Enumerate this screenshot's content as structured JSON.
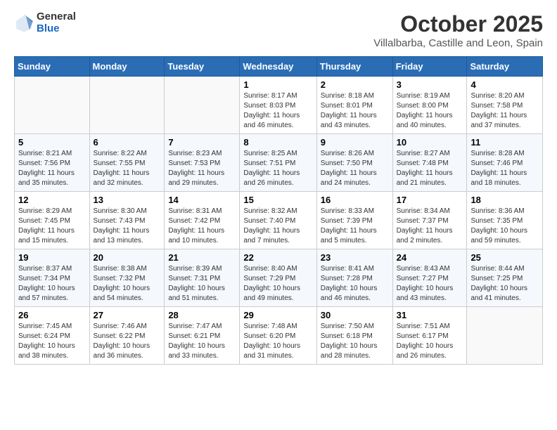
{
  "header": {
    "logo_general": "General",
    "logo_blue": "Blue",
    "month_title": "October 2025",
    "location": "Villalbarba, Castille and Leon, Spain"
  },
  "weekdays": [
    "Sunday",
    "Monday",
    "Tuesday",
    "Wednesday",
    "Thursday",
    "Friday",
    "Saturday"
  ],
  "weeks": [
    [
      {
        "day": "",
        "sunrise": "",
        "sunset": "",
        "daylight": ""
      },
      {
        "day": "",
        "sunrise": "",
        "sunset": "",
        "daylight": ""
      },
      {
        "day": "",
        "sunrise": "",
        "sunset": "",
        "daylight": ""
      },
      {
        "day": "1",
        "sunrise": "Sunrise: 8:17 AM",
        "sunset": "Sunset: 8:03 PM",
        "daylight": "Daylight: 11 hours and 46 minutes."
      },
      {
        "day": "2",
        "sunrise": "Sunrise: 8:18 AM",
        "sunset": "Sunset: 8:01 PM",
        "daylight": "Daylight: 11 hours and 43 minutes."
      },
      {
        "day": "3",
        "sunrise": "Sunrise: 8:19 AM",
        "sunset": "Sunset: 8:00 PM",
        "daylight": "Daylight: 11 hours and 40 minutes."
      },
      {
        "day": "4",
        "sunrise": "Sunrise: 8:20 AM",
        "sunset": "Sunset: 7:58 PM",
        "daylight": "Daylight: 11 hours and 37 minutes."
      }
    ],
    [
      {
        "day": "5",
        "sunrise": "Sunrise: 8:21 AM",
        "sunset": "Sunset: 7:56 PM",
        "daylight": "Daylight: 11 hours and 35 minutes."
      },
      {
        "day": "6",
        "sunrise": "Sunrise: 8:22 AM",
        "sunset": "Sunset: 7:55 PM",
        "daylight": "Daylight: 11 hours and 32 minutes."
      },
      {
        "day": "7",
        "sunrise": "Sunrise: 8:23 AM",
        "sunset": "Sunset: 7:53 PM",
        "daylight": "Daylight: 11 hours and 29 minutes."
      },
      {
        "day": "8",
        "sunrise": "Sunrise: 8:25 AM",
        "sunset": "Sunset: 7:51 PM",
        "daylight": "Daylight: 11 hours and 26 minutes."
      },
      {
        "day": "9",
        "sunrise": "Sunrise: 8:26 AM",
        "sunset": "Sunset: 7:50 PM",
        "daylight": "Daylight: 11 hours and 24 minutes."
      },
      {
        "day": "10",
        "sunrise": "Sunrise: 8:27 AM",
        "sunset": "Sunset: 7:48 PM",
        "daylight": "Daylight: 11 hours and 21 minutes."
      },
      {
        "day": "11",
        "sunrise": "Sunrise: 8:28 AM",
        "sunset": "Sunset: 7:46 PM",
        "daylight": "Daylight: 11 hours and 18 minutes."
      }
    ],
    [
      {
        "day": "12",
        "sunrise": "Sunrise: 8:29 AM",
        "sunset": "Sunset: 7:45 PM",
        "daylight": "Daylight: 11 hours and 15 minutes."
      },
      {
        "day": "13",
        "sunrise": "Sunrise: 8:30 AM",
        "sunset": "Sunset: 7:43 PM",
        "daylight": "Daylight: 11 hours and 13 minutes."
      },
      {
        "day": "14",
        "sunrise": "Sunrise: 8:31 AM",
        "sunset": "Sunset: 7:42 PM",
        "daylight": "Daylight: 11 hours and 10 minutes."
      },
      {
        "day": "15",
        "sunrise": "Sunrise: 8:32 AM",
        "sunset": "Sunset: 7:40 PM",
        "daylight": "Daylight: 11 hours and 7 minutes."
      },
      {
        "day": "16",
        "sunrise": "Sunrise: 8:33 AM",
        "sunset": "Sunset: 7:39 PM",
        "daylight": "Daylight: 11 hours and 5 minutes."
      },
      {
        "day": "17",
        "sunrise": "Sunrise: 8:34 AM",
        "sunset": "Sunset: 7:37 PM",
        "daylight": "Daylight: 11 hours and 2 minutes."
      },
      {
        "day": "18",
        "sunrise": "Sunrise: 8:36 AM",
        "sunset": "Sunset: 7:35 PM",
        "daylight": "Daylight: 10 hours and 59 minutes."
      }
    ],
    [
      {
        "day": "19",
        "sunrise": "Sunrise: 8:37 AM",
        "sunset": "Sunset: 7:34 PM",
        "daylight": "Daylight: 10 hours and 57 minutes."
      },
      {
        "day": "20",
        "sunrise": "Sunrise: 8:38 AM",
        "sunset": "Sunset: 7:32 PM",
        "daylight": "Daylight: 10 hours and 54 minutes."
      },
      {
        "day": "21",
        "sunrise": "Sunrise: 8:39 AM",
        "sunset": "Sunset: 7:31 PM",
        "daylight": "Daylight: 10 hours and 51 minutes."
      },
      {
        "day": "22",
        "sunrise": "Sunrise: 8:40 AM",
        "sunset": "Sunset: 7:29 PM",
        "daylight": "Daylight: 10 hours and 49 minutes."
      },
      {
        "day": "23",
        "sunrise": "Sunrise: 8:41 AM",
        "sunset": "Sunset: 7:28 PM",
        "daylight": "Daylight: 10 hours and 46 minutes."
      },
      {
        "day": "24",
        "sunrise": "Sunrise: 8:43 AM",
        "sunset": "Sunset: 7:27 PM",
        "daylight": "Daylight: 10 hours and 43 minutes."
      },
      {
        "day": "25",
        "sunrise": "Sunrise: 8:44 AM",
        "sunset": "Sunset: 7:25 PM",
        "daylight": "Daylight: 10 hours and 41 minutes."
      }
    ],
    [
      {
        "day": "26",
        "sunrise": "Sunrise: 7:45 AM",
        "sunset": "Sunset: 6:24 PM",
        "daylight": "Daylight: 10 hours and 38 minutes."
      },
      {
        "day": "27",
        "sunrise": "Sunrise: 7:46 AM",
        "sunset": "Sunset: 6:22 PM",
        "daylight": "Daylight: 10 hours and 36 minutes."
      },
      {
        "day": "28",
        "sunrise": "Sunrise: 7:47 AM",
        "sunset": "Sunset: 6:21 PM",
        "daylight": "Daylight: 10 hours and 33 minutes."
      },
      {
        "day": "29",
        "sunrise": "Sunrise: 7:48 AM",
        "sunset": "Sunset: 6:20 PM",
        "daylight": "Daylight: 10 hours and 31 minutes."
      },
      {
        "day": "30",
        "sunrise": "Sunrise: 7:50 AM",
        "sunset": "Sunset: 6:18 PM",
        "daylight": "Daylight: 10 hours and 28 minutes."
      },
      {
        "day": "31",
        "sunrise": "Sunrise: 7:51 AM",
        "sunset": "Sunset: 6:17 PM",
        "daylight": "Daylight: 10 hours and 26 minutes."
      },
      {
        "day": "",
        "sunrise": "",
        "sunset": "",
        "daylight": ""
      }
    ]
  ]
}
